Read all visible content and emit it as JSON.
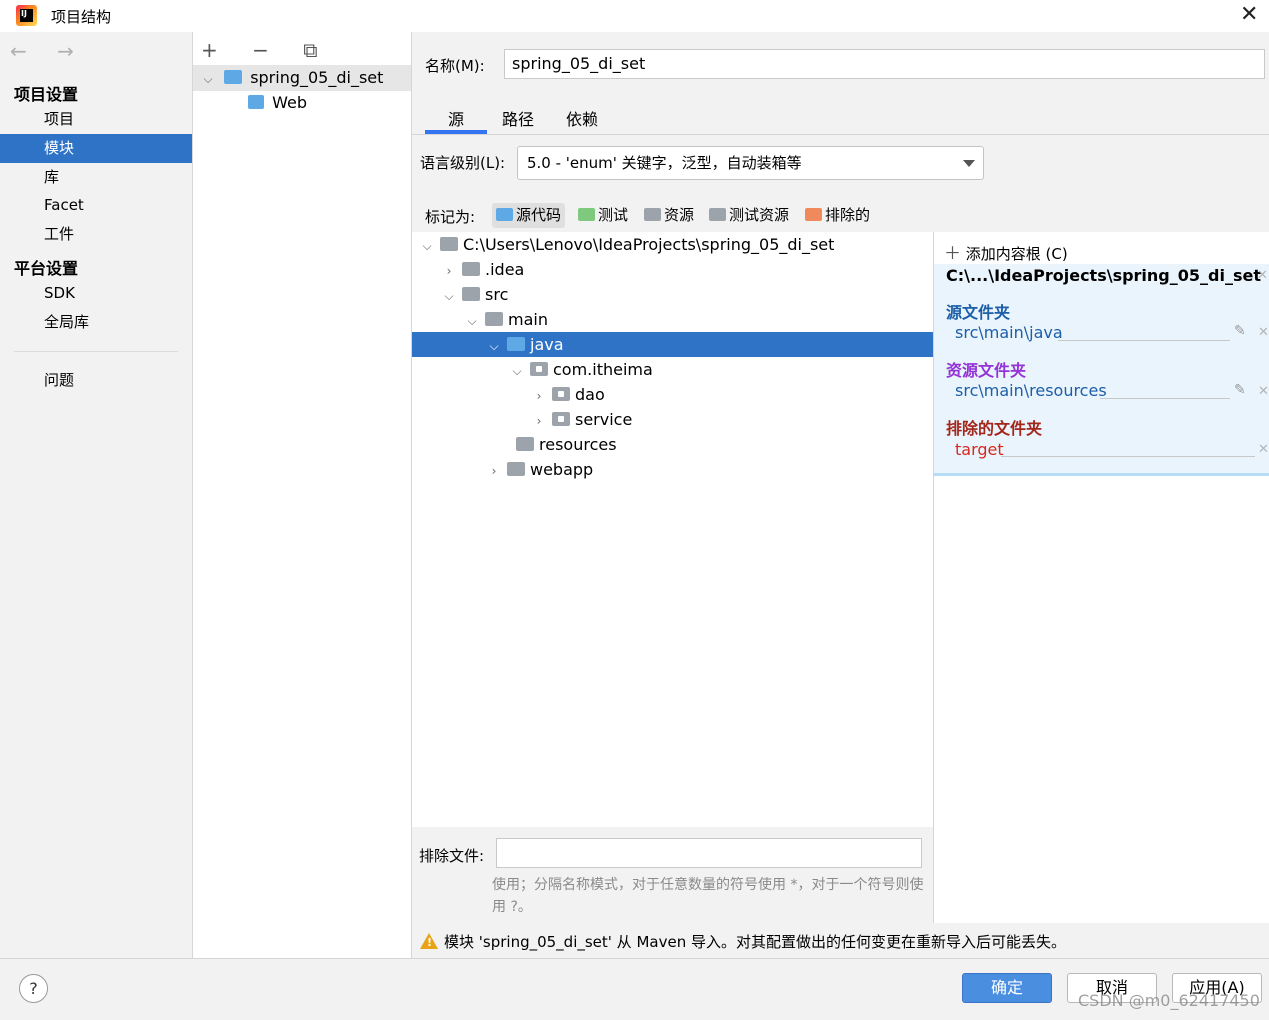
{
  "window": {
    "title": "项目结构",
    "logo_text": "IJ"
  },
  "nav": {
    "back_arrows": "← →",
    "sections": [
      {
        "label": "项目设置",
        "items": [
          "项目",
          "模块",
          "库",
          "Facet",
          "工件"
        ]
      },
      {
        "label": "平台设置",
        "items": [
          "SDK",
          "全局库"
        ]
      }
    ],
    "problems": "问题",
    "selected": "模块"
  },
  "modules": {
    "toolbar": "+ − ⧉",
    "items": [
      {
        "label": "spring_05_di_set",
        "expanded": true,
        "selected": true
      },
      {
        "label": "Web",
        "child": true
      }
    ]
  },
  "detail": {
    "name_label": "名称(M):",
    "name_value": "spring_05_di_set",
    "tabs": [
      "源",
      "路径",
      "依赖"
    ],
    "active_tab": "源",
    "language_label": "语言级别(L):",
    "language_value": "5.0 - 'enum' 关键字，泛型，自动装箱等",
    "mark_label": "标记为:",
    "marks": [
      {
        "label": "源代码",
        "color": "#5fa8e6"
      },
      {
        "label": "测试",
        "color": "#7fc97f"
      },
      {
        "label": "资源",
        "color": "#9da3ab"
      },
      {
        "label": "测试资源",
        "color": "#9da3ab"
      },
      {
        "label": "排除的",
        "color": "#f08a5d"
      }
    ]
  },
  "tree": [
    {
      "label": "C:\\Users\\Lenovo\\IdeaProjects\\spring_05_di_set",
      "depth": 0,
      "chev": "down"
    },
    {
      "label": ".idea",
      "depth": 1,
      "chev": "right"
    },
    {
      "label": "src",
      "depth": 1,
      "chev": "down"
    },
    {
      "label": "main",
      "depth": 2,
      "chev": "down"
    },
    {
      "label": "java",
      "depth": 3,
      "chev": "down",
      "selected": true
    },
    {
      "label": "com.itheima",
      "depth": 4,
      "chev": "down"
    },
    {
      "label": "dao",
      "depth": 5,
      "chev": "right"
    },
    {
      "label": "service",
      "depth": 5,
      "chev": "right"
    },
    {
      "label": "resources",
      "depth": 4,
      "chev": ""
    },
    {
      "label": "webapp",
      "depth": 3,
      "chev": "right"
    }
  ],
  "roots": {
    "add_label": "添加内容根 (C)",
    "root_path": "C:\\...\\IdeaProjects\\spring_05_di_set",
    "source_head": "源文件夹",
    "source_item": "src\\main\\java",
    "resource_head": "资源文件夹",
    "resource_item": "src\\main\\resources",
    "excluded_head": "排除的文件夹",
    "excluded_item": "target",
    "colors": {
      "source": "#1c5ea8",
      "resource": "#9333d6",
      "excluded": "#a3261b"
    }
  },
  "exclude": {
    "label": "排除文件:",
    "help": "使用；分隔名称模式，对于任意数量的符号使用 *，对于一个符号则使用 ?。"
  },
  "warning": "模块 'spring_05_di_set' 从 Maven 导入。对其配置做出的任何变更在重新导入后可能丢失。",
  "buttons": {
    "ok": "确定",
    "cancel": "取消",
    "apply": "应用(A)",
    "help": "?"
  },
  "watermark": "CSDN @m0_62417450"
}
